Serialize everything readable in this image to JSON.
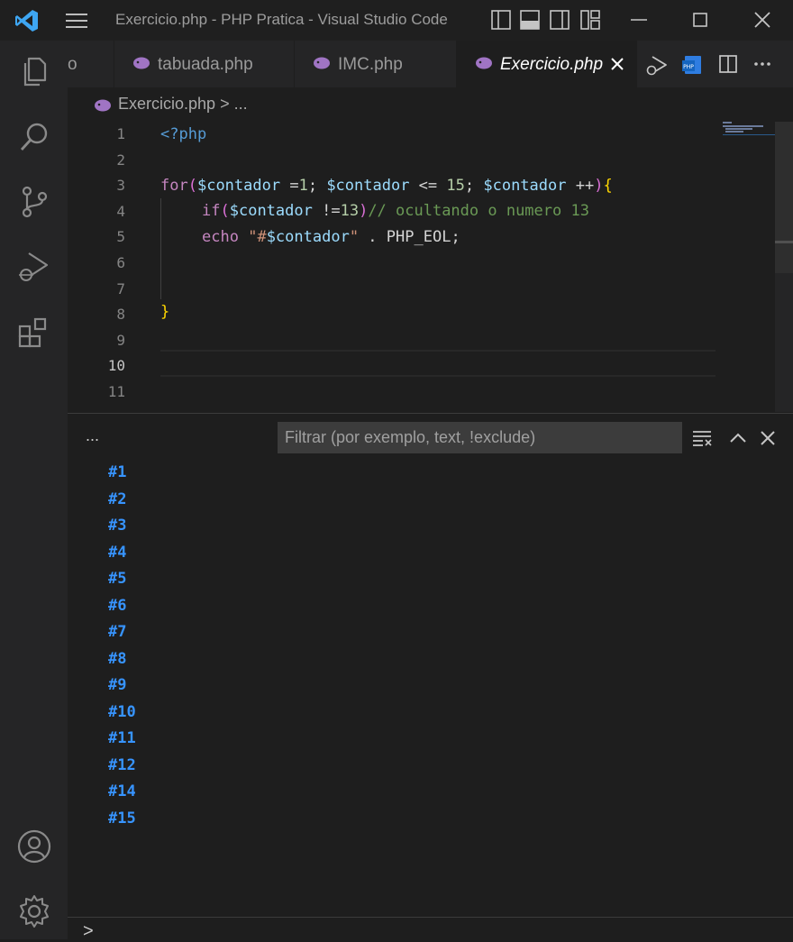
{
  "window": {
    "title": "Exercicio.php - PHP Pratica - Visual Studio Code"
  },
  "tabs": [
    {
      "label": "o",
      "active": false
    },
    {
      "label": "tabuada.php",
      "active": false
    },
    {
      "label": "IMC.php",
      "active": false
    },
    {
      "label": "Exercicio.php",
      "active": true
    }
  ],
  "breadcrumb": {
    "file": "Exercicio.php",
    "separator": ">",
    "rest": "..."
  },
  "editor": {
    "line_numbers": [
      "1",
      "2",
      "3",
      "4",
      "5",
      "6",
      "7",
      "8",
      "9",
      "10",
      "11"
    ],
    "current_line": "10",
    "lines": {
      "l1": {
        "open_tag": "<?php"
      },
      "l3": {
        "kw": "for",
        "p1": "(",
        "v1": "$contador",
        "t1": " =",
        "n1": "1",
        "t2": "; ",
        "v2": "$contador",
        "t3": " <= ",
        "n2": "15",
        "t4": "; ",
        "v3": "$contador",
        "t5": " ++",
        "p2": ")",
        "b1": "{"
      },
      "l4": {
        "kw": "if",
        "p1": "(",
        "v1": "$contador",
        "t1": " !=",
        "n1": "13",
        "p2": ")",
        "comment": "// ocultando o numero 13"
      },
      "l5": {
        "kw": "echo",
        "sp": " ",
        "q1": "\"#",
        "v1": "$contador",
        "q2": "\"",
        "t1": " . ",
        "c1": "PHP_EOL",
        "t2": ";"
      },
      "l8": {
        "b1": "}"
      }
    }
  },
  "panel": {
    "more": "...",
    "filter_placeholder": "Filtrar (por exemplo, text, !exclude)",
    "output": [
      "#1",
      "#2",
      "#3",
      "#4",
      "#5",
      "#6",
      "#7",
      "#8",
      "#9",
      "#10",
      "#11",
      "#12",
      "#14",
      "#15"
    ],
    "prompt": ">"
  },
  "colors": {
    "accent": "#007acc",
    "output_text": "#3794ff",
    "php_icon": "#a074c4"
  },
  "icons": [
    "vscode-logo-icon",
    "menu-icon",
    "layout-icons",
    "minimize-icon",
    "maximize-icon",
    "close-icon",
    "explorer-icon",
    "search-icon",
    "source-control-icon",
    "run-debug-icon",
    "extensions-icon",
    "account-icon",
    "settings-gear-icon",
    "php-file-icon",
    "run-php-icon",
    "split-editor-icon",
    "more-actions-icon",
    "clear-output-icon",
    "chevron-up-icon",
    "close-panel-icon"
  ]
}
